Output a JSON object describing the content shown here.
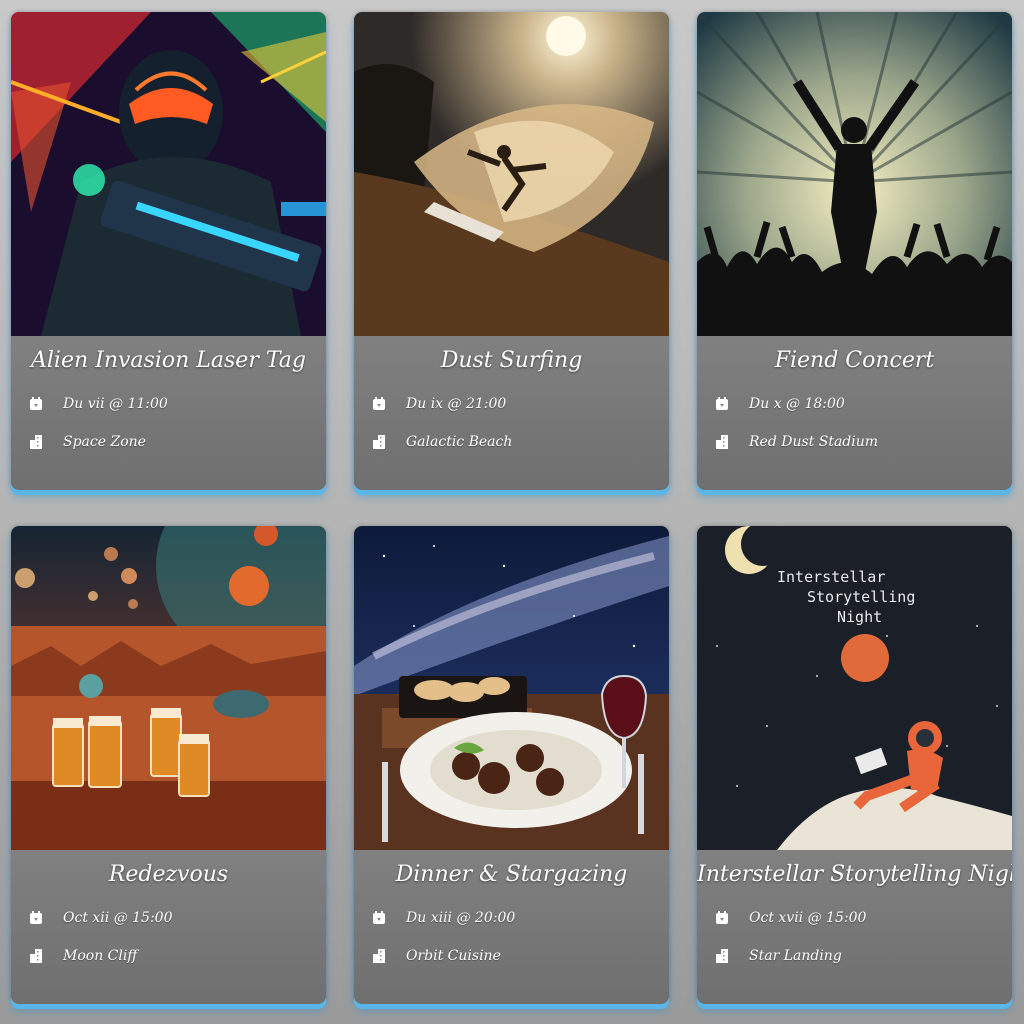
{
  "events": [
    {
      "title": "Alien Invasion Laser Tag",
      "date": "Du vii @ 11:00",
      "venue": "Space Zone",
      "image": "alien-laser-tag-image"
    },
    {
      "title": "Dust Surfing",
      "date": "Du ix @ 21:00",
      "venue": "Galactic Beach",
      "image": "dust-surfer-image"
    },
    {
      "title": "Fiend Concert",
      "date": "Du x @ 18:00",
      "venue": "Red Dust Stadium",
      "image": "concert-crowd-image"
    },
    {
      "title": "Redezvous",
      "date": "Oct xii @ 15:00",
      "venue": "Moon Cliff",
      "image": "mars-beer-image"
    },
    {
      "title": "Dinner & Stargazing",
      "date": "Du xiii @ 20:00",
      "venue": "Orbit Cuisine",
      "image": "dinner-stargazing-image"
    },
    {
      "title": "Interstellar Storytelling Night",
      "date": "Oct xvii @ 15:00",
      "venue": "Star Landing",
      "image": "storytelling-poster-image",
      "poster_lines": [
        "Interstellar",
        "Storytelling",
        "Night"
      ]
    }
  ],
  "icons": {
    "date": "calendar-icon",
    "venue": "building-icon"
  },
  "colors": {
    "accent_glow": "#5ab6e8",
    "card_top": "#9b9b9b",
    "card_bottom": "#6f6f6f",
    "text": "#ffffff"
  }
}
